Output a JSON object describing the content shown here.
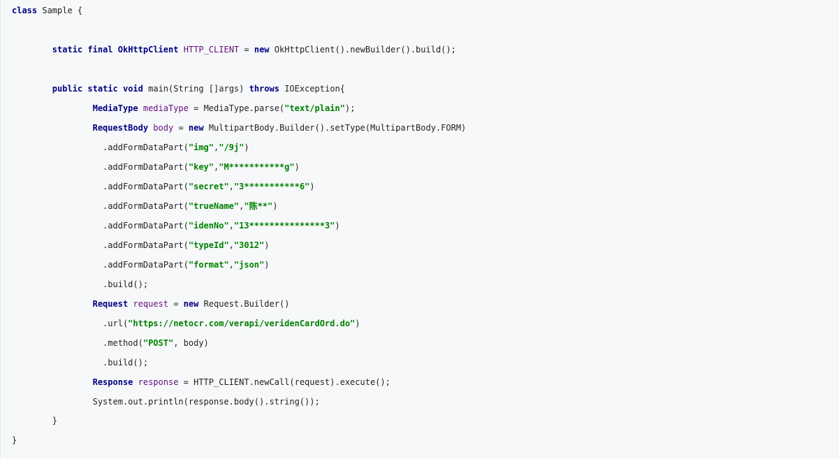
{
  "code": {
    "lines": [
      {
        "indent": "",
        "tokens": [
          {
            "t": "class",
            "k": "kw"
          },
          {
            "t": " Sample {",
            "k": "plain"
          }
        ]
      },
      {
        "indent": "",
        "tokens": []
      },
      {
        "indent": "",
        "tokens": []
      },
      {
        "indent": "        ",
        "tokens": [
          {
            "t": "static",
            "k": "kw"
          },
          {
            "t": " ",
            "k": "plain"
          },
          {
            "t": "final",
            "k": "kw"
          },
          {
            "t": " ",
            "k": "plain"
          },
          {
            "t": "OkHttpClient",
            "k": "type"
          },
          {
            "t": " ",
            "k": "plain"
          },
          {
            "t": "HTTP_CLIENT",
            "k": "var"
          },
          {
            "t": " = ",
            "k": "plain"
          },
          {
            "t": "new",
            "k": "kw"
          },
          {
            "t": " OkHttpClient().newBuilder().build();",
            "k": "plain"
          }
        ]
      },
      {
        "indent": "",
        "tokens": []
      },
      {
        "indent": "",
        "tokens": []
      },
      {
        "indent": "        ",
        "tokens": [
          {
            "t": "public",
            "k": "kw"
          },
          {
            "t": " ",
            "k": "plain"
          },
          {
            "t": "static",
            "k": "kw"
          },
          {
            "t": " ",
            "k": "plain"
          },
          {
            "t": "void",
            "k": "kw"
          },
          {
            "t": " main(String []args) ",
            "k": "plain"
          },
          {
            "t": "throws",
            "k": "kw"
          },
          {
            "t": " IOException{",
            "k": "plain"
          }
        ]
      },
      {
        "indent": "                ",
        "tokens": [
          {
            "t": "MediaType",
            "k": "type"
          },
          {
            "t": " ",
            "k": "plain"
          },
          {
            "t": "mediaType",
            "k": "var"
          },
          {
            "t": " = MediaType.parse(",
            "k": "plain"
          },
          {
            "t": "\"text/plain\"",
            "k": "str"
          },
          {
            "t": ");",
            "k": "plain"
          }
        ]
      },
      {
        "indent": "                ",
        "tokens": [
          {
            "t": "RequestBody",
            "k": "type"
          },
          {
            "t": " ",
            "k": "plain"
          },
          {
            "t": "body",
            "k": "var"
          },
          {
            "t": " = ",
            "k": "plain"
          },
          {
            "t": "new",
            "k": "kw"
          },
          {
            "t": " MultipartBody.Builder().setType(MultipartBody.FORM)",
            "k": "plain"
          }
        ]
      },
      {
        "indent": "                  ",
        "tokens": [
          {
            "t": ".addFormDataPart(",
            "k": "plain"
          },
          {
            "t": "\"img\"",
            "k": "str"
          },
          {
            "t": ",",
            "k": "plain"
          },
          {
            "t": "\"/9j\"",
            "k": "str"
          },
          {
            "t": ")",
            "k": "plain"
          }
        ]
      },
      {
        "indent": "                  ",
        "tokens": [
          {
            "t": ".addFormDataPart(",
            "k": "plain"
          },
          {
            "t": "\"key\"",
            "k": "str"
          },
          {
            "t": ",",
            "k": "plain"
          },
          {
            "t": "\"M***********g\"",
            "k": "str"
          },
          {
            "t": ")",
            "k": "plain"
          }
        ]
      },
      {
        "indent": "                  ",
        "tokens": [
          {
            "t": ".addFormDataPart(",
            "k": "plain"
          },
          {
            "t": "\"secret\"",
            "k": "str"
          },
          {
            "t": ",",
            "k": "plain"
          },
          {
            "t": "\"3***********6\"",
            "k": "str"
          },
          {
            "t": ")",
            "k": "plain"
          }
        ]
      },
      {
        "indent": "                  ",
        "tokens": [
          {
            "t": ".addFormDataPart(",
            "k": "plain"
          },
          {
            "t": "\"trueName\"",
            "k": "str"
          },
          {
            "t": ",",
            "k": "plain"
          },
          {
            "t": "\"陈**\"",
            "k": "str"
          },
          {
            "t": ")",
            "k": "plain"
          }
        ]
      },
      {
        "indent": "                  ",
        "tokens": [
          {
            "t": ".addFormDataPart(",
            "k": "plain"
          },
          {
            "t": "\"idenNo\"",
            "k": "str"
          },
          {
            "t": ",",
            "k": "plain"
          },
          {
            "t": "\"13***************3\"",
            "k": "str"
          },
          {
            "t": ")",
            "k": "plain"
          }
        ]
      },
      {
        "indent": "                  ",
        "tokens": [
          {
            "t": ".addFormDataPart(",
            "k": "plain"
          },
          {
            "t": "\"typeId\"",
            "k": "str"
          },
          {
            "t": ",",
            "k": "plain"
          },
          {
            "t": "\"3012\"",
            "k": "str"
          },
          {
            "t": ")",
            "k": "plain"
          }
        ]
      },
      {
        "indent": "                  ",
        "tokens": [
          {
            "t": ".addFormDataPart(",
            "k": "plain"
          },
          {
            "t": "\"format\"",
            "k": "str"
          },
          {
            "t": ",",
            "k": "plain"
          },
          {
            "t": "\"json\"",
            "k": "str"
          },
          {
            "t": ")",
            "k": "plain"
          }
        ]
      },
      {
        "indent": "                  ",
        "tokens": [
          {
            "t": ".build();",
            "k": "plain"
          }
        ]
      },
      {
        "indent": "                ",
        "tokens": [
          {
            "t": "Request",
            "k": "type"
          },
          {
            "t": " ",
            "k": "plain"
          },
          {
            "t": "request",
            "k": "var"
          },
          {
            "t": " = ",
            "k": "plain"
          },
          {
            "t": "new",
            "k": "kw"
          },
          {
            "t": " Request.Builder()",
            "k": "plain"
          }
        ]
      },
      {
        "indent": "                  ",
        "tokens": [
          {
            "t": ".url(",
            "k": "plain"
          },
          {
            "t": "\"https://netocr.com/verapi/veridenCardOrd.do\"",
            "k": "str"
          },
          {
            "t": ")",
            "k": "plain"
          }
        ]
      },
      {
        "indent": "                  ",
        "tokens": [
          {
            "t": ".method(",
            "k": "plain"
          },
          {
            "t": "\"POST\"",
            "k": "str"
          },
          {
            "t": ", body)",
            "k": "plain"
          }
        ]
      },
      {
        "indent": "                  ",
        "tokens": [
          {
            "t": ".build();",
            "k": "plain"
          }
        ]
      },
      {
        "indent": "                ",
        "tokens": [
          {
            "t": "Response",
            "k": "type"
          },
          {
            "t": " ",
            "k": "plain"
          },
          {
            "t": "response",
            "k": "var"
          },
          {
            "t": " = HTTP_CLIENT.newCall(request).execute();",
            "k": "plain"
          }
        ]
      },
      {
        "indent": "                ",
        "tokens": [
          {
            "t": "System.out.println(response.body().string());",
            "k": "plain"
          }
        ]
      },
      {
        "indent": "        ",
        "tokens": [
          {
            "t": "}",
            "k": "plain"
          }
        ]
      },
      {
        "indent": "",
        "tokens": []
      },
      {
        "indent": "",
        "tokens": [
          {
            "t": "}",
            "k": "plain"
          }
        ]
      }
    ]
  }
}
